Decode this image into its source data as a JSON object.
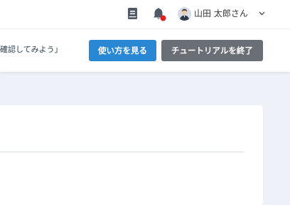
{
  "header": {
    "icons": {
      "book": "book-icon",
      "bell": "bell-icon",
      "notification_dot_color": "#e02020"
    },
    "user": {
      "name": "山田 太郎さん",
      "menu_icon": "chevron-down-icon"
    }
  },
  "tutorial": {
    "text": "確認してみよう」",
    "guide_button": "使い方を見る",
    "end_button": "チュートリアルを終了"
  },
  "colors": {
    "primary": "#2a87d4",
    "secondary": "#6a6f76",
    "background": "#eef2f8"
  }
}
